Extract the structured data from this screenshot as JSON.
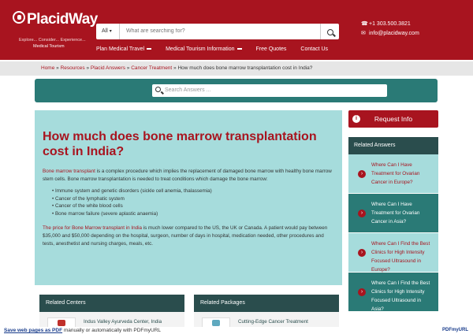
{
  "header": {
    "logo_text": "PlacidWay",
    "logo_tagline": "Explore... Consider... Experience...",
    "logo_subtitle": "Medical Tourism",
    "search_category": "All",
    "search_placeholder": "What are searching for?",
    "nav": [
      {
        "label": "Plan Medical Travel"
      },
      {
        "label": "Medical Tourism Information"
      },
      {
        "label": "Free Quotes"
      },
      {
        "label": "Contact Us"
      }
    ],
    "phone": "+1 303.500.3821",
    "email": "info@placidway.com"
  },
  "breadcrumb": {
    "home": "Home",
    "resources": "Resources",
    "placid_answers": "Placid Answers",
    "cancer_treatment": "Cancer Treatment",
    "current": "How much does bone marrow transplantation cost in India?"
  },
  "answers_search": {
    "placeholder": "Search Answers ..."
  },
  "article": {
    "title": "How much does bone marrow transplantation cost in India?",
    "para1_link": "Bone marrow transplant",
    "para1_text": " is a complex procedure which implies the replacement of damaged bone marrow with healthy bone marrow stem cells. Bone marrow transplantation is needed  to  treat conditions which damage the bone marrow:",
    "bullets": [
      "Immune system and genetic disorders (sickle cell anemia, thalassemia)",
      "Cancer of the lymphatic system",
      "Cancer of the white blood cells",
      "Bone marrow failure (severe aplastic anaemia)"
    ],
    "para2_link": "The price for Bone Marrow transplant in India",
    "para2_text": " is much lower compared to the US, the UK or Canada. A patient would pay between $35,000 and $50,000 depending on the hospital, surgeon, number of days in hospital, medication needed, other procedures and tests, anesthetist and nursing charges, meals, etc."
  },
  "sidebar": {
    "request_label": "Request Info",
    "related_heading": "Related Answers",
    "related": [
      "Where Can I Have Treatment for Ovarian Cancer in Europe?",
      "Where Can I Have Treatment for Ovarian Cancer in Asia?",
      "Where Can I Find the Best Clinics for High Intensity Focused Ultrasound in Europe?",
      "Where Can I Find the Best Clinics for High Intensity Focused Ultrasound in Asia?"
    ]
  },
  "bottom": {
    "centers_heading": "Related Centers",
    "centers_item": "Indus Valley Ayurveda Center, India",
    "packages_heading": "Related Packages",
    "packages_item": "Cutting-Edge Cancer Treatment"
  },
  "pdf_footer": {
    "link_text": "Save web pages as PDF",
    "rest": " manually or automatically with PDFmyURL",
    "logo": "PDFmyURL"
  }
}
